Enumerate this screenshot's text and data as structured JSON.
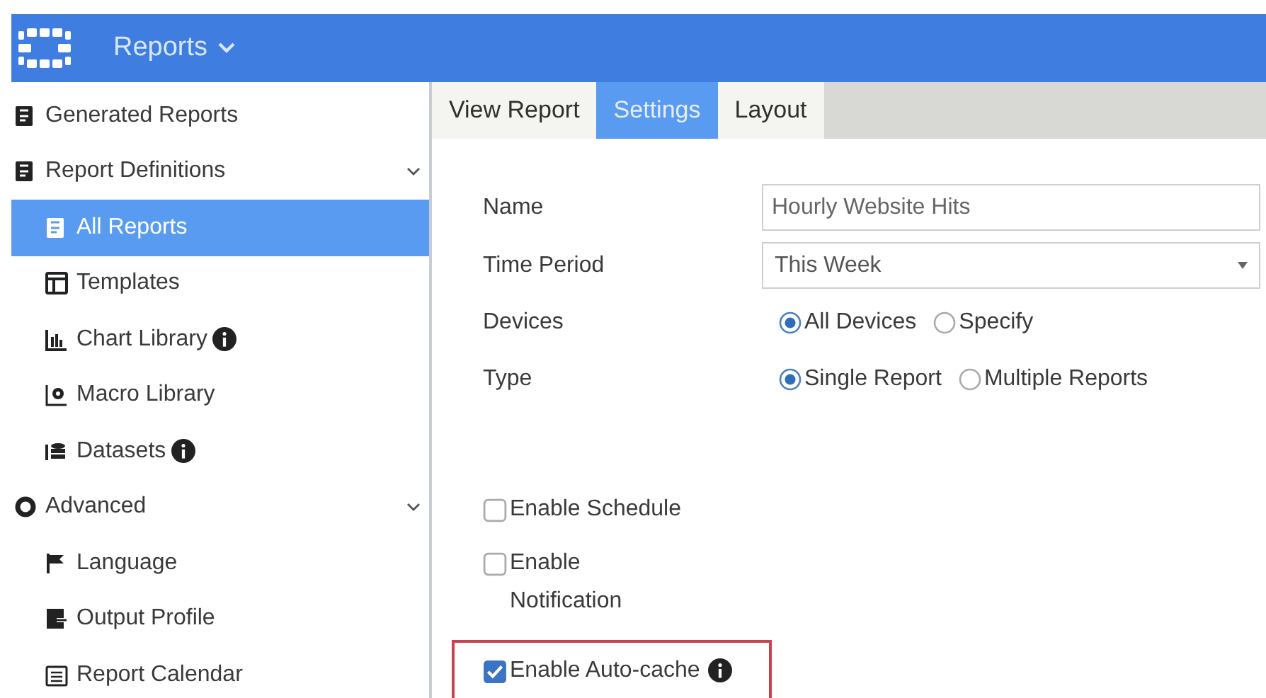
{
  "header": {
    "title": "Reports"
  },
  "sidebar": {
    "items": [
      {
        "label": "Generated Reports",
        "selected": false
      },
      {
        "label": "Report Definitions",
        "selected": false,
        "expanded": true,
        "children": [
          {
            "label": "All Reports",
            "selected": true
          },
          {
            "label": "Templates",
            "selected": false
          },
          {
            "label": "Chart Library",
            "selected": false,
            "info": true
          },
          {
            "label": "Macro Library",
            "selected": false
          },
          {
            "label": "Datasets",
            "selected": false,
            "info": true
          }
        ]
      },
      {
        "label": "Advanced",
        "selected": false,
        "expanded": true,
        "children": [
          {
            "label": "Language",
            "selected": false
          },
          {
            "label": "Output Profile",
            "selected": false
          },
          {
            "label": "Report Calendar",
            "selected": false
          }
        ]
      }
    ]
  },
  "tabs": [
    {
      "label": "View Report",
      "selected": false
    },
    {
      "label": "Settings",
      "selected": true
    },
    {
      "label": "Layout",
      "selected": false
    }
  ],
  "form": {
    "fields": [
      {
        "kind": "text",
        "label": "Name",
        "value": "Hourly Website Hits"
      },
      {
        "kind": "select",
        "label": "Time Period",
        "value": "This Week"
      },
      {
        "kind": "radio",
        "label": "Devices",
        "options": [
          {
            "label": "All Devices",
            "selected": true
          },
          {
            "label": "Specify",
            "selected": false
          }
        ]
      },
      {
        "kind": "radio",
        "label": "Type",
        "options": [
          {
            "label": "Single Report",
            "selected": true
          },
          {
            "label": "Multiple Reports",
            "selected": false
          }
        ]
      }
    ],
    "checkboxes": [
      {
        "label": "Enable Schedule",
        "checked": false,
        "highlighted": false
      },
      {
        "label": "Enable Notification",
        "checked": false,
        "highlighted": false
      },
      {
        "label": "Enable Auto-cache",
        "checked": true,
        "highlighted": true,
        "info": true
      }
    ]
  }
}
